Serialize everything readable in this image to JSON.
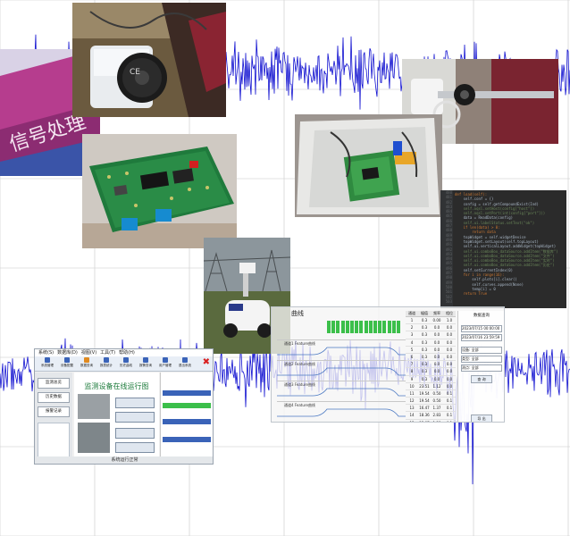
{
  "colors": {
    "signal": "#1010d0",
    "grid": "#c8c8c8",
    "banner_text": "#1b7a3a",
    "code_bg": "#2b2b2b",
    "code_text": "#a9b7c6",
    "code_keyword": "#cc7832",
    "code_string": "#6a8759",
    "window_bg": "#f0f0f0",
    "ui_blue": "#1f4e99",
    "ok_green": "#3bbf4a",
    "alert_red": "#d92020"
  },
  "photos": {
    "sign_text": "信号处理",
    "sensor_label": "CE",
    "robot": "inspection-robot",
    "pcb_left": "green-circuit-board",
    "pcb_box": "circuit-board-in-enclosure",
    "cable_bolt": "cable-and-bolt"
  },
  "monitor_app": {
    "banner": "监测设备在线运行图",
    "menu": [
      "系统(S)",
      "数据库(D)",
      "视图(V)",
      "工具(T)",
      "帮助(H)"
    ],
    "toolbar": [
      "系统管理",
      "设备配置",
      "数据查询",
      "报表统计",
      "历史曲线",
      "报警查询",
      "用户管理",
      "退出系统"
    ],
    "left_buttons": [
      "监测总览",
      "历史数据",
      "报警记录"
    ],
    "status": "系统运行正常"
  },
  "curve_app": {
    "title": "曲线",
    "panels": [
      "通道1 Feature曲线",
      "通道2 Feature曲线",
      "通道3 Feature曲线",
      "通道4 Feature曲线"
    ],
    "table_headers": [
      "通道",
      "幅值",
      "频率",
      "相位"
    ],
    "table_rows": [
      [
        "1",
        "0.3",
        "0.00",
        "1.0"
      ],
      [
        "2",
        "0.3",
        "0.0",
        "0.0"
      ],
      [
        "3",
        "0.3",
        "0.0",
        "0.0"
      ],
      [
        "4",
        "0.3",
        "0.0",
        "0.0"
      ],
      [
        "5",
        "0.3",
        "0.0",
        "0.0"
      ],
      [
        "6",
        "0.3",
        "0.0",
        "0.0"
      ],
      [
        "7",
        "0.3",
        "0.0",
        "0.0"
      ],
      [
        "8",
        "0.3",
        "0.0",
        "0.0"
      ],
      [
        "9",
        "0.3",
        "0.0",
        "0.0"
      ],
      [
        "10",
        "23.51",
        "1.12",
        "0.0"
      ],
      [
        "11",
        "19.54",
        "0.50",
        "0.1"
      ],
      [
        "12",
        "19.54",
        "0.50",
        "0.1"
      ],
      [
        "13",
        "16.47",
        "1.37",
        "0.1"
      ],
      [
        "14",
        "18.36",
        "2.83",
        "0.1"
      ],
      [
        "15",
        "15.07",
        "1.38",
        "0.1"
      ],
      [
        "16",
        "17.24",
        "1.38",
        "0.1"
      ]
    ],
    "query_panel": {
      "title": "数据查询",
      "start_time": "2023/07/15 00:00:00",
      "end_time": "2023/07/16 23:59:59",
      "fields": [
        "设备: 全部",
        "类型: 全部",
        "测点: 全部"
      ],
      "buttons": [
        "查 询",
        "导 出"
      ]
    }
  },
  "code_lines": [
    "def load(self):",
    "    self.conf = {}",
    "    config = self.getCompoundExist(Ind)",
    "    self.oqsl.setHost(config[\"host\"])",
    "    self.oqsl.setPort(int(config[\"port\"]))",
    "    data = ReadData(config)",
    "    self.ui.labelStatus.setText(\"ok\")",
    "    if len(data) > 0:",
    "        return data",
    "    topWidget = self.widgetDevice",
    "    topWidget.setLayout(self.topLayout)",
    "    self.ui.verticalLayout.addWidget(topWidget)",
    "",
    "    self.ui.comboBox_dataSource.addItem(\"数据库\")",
    "    self.ui.comboBox_dataSource.addItem(\"文件\")",
    "    self.ui.comboBox_dataSource.addItem(\"实时\")",
    "    self.ui.comboBox_dataSource.addItem(\"历史\")",
    "",
    "    self.setCurrentIndex(0)",
    "    for i in range(16):",
    "        self.plots[i].clear()",
    "        self.curves.append(None)",
    "        temp[i] = 0",
    "    return True"
  ]
}
